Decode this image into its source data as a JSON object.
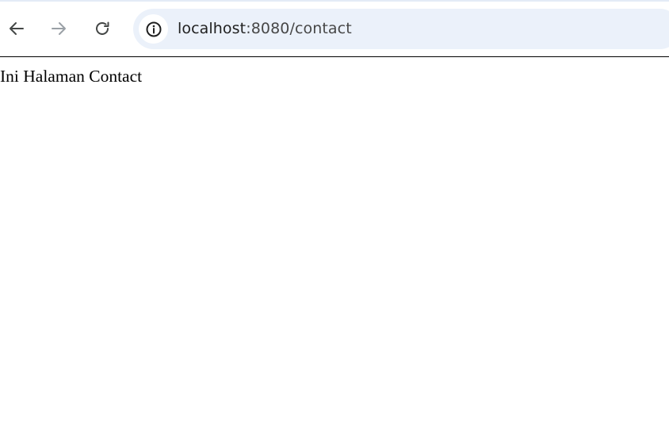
{
  "browser": {
    "address_bar": {
      "url_host": "localhost",
      "url_rest": ":8080/contact"
    },
    "icons": {
      "back": "arrow-left-icon",
      "forward": "arrow-right-icon",
      "reload": "reload-icon",
      "site_info": "info-icon"
    },
    "colors": {
      "omnibox_bg": "#ebf1fa",
      "icon_active": "#444746",
      "icon_disabled": "#9aa0a6"
    }
  },
  "page": {
    "body_text": "Ini Halaman Contact"
  }
}
